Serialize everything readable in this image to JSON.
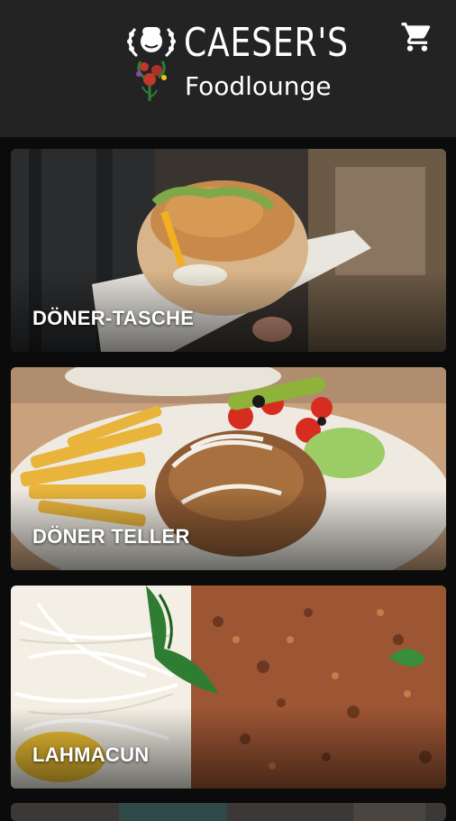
{
  "header": {
    "brand_title": "CAESER'S",
    "brand_subtitle": "Foodlounge",
    "cart_icon": "shopping-cart-icon"
  },
  "menu": {
    "categories": [
      {
        "label": "DÖNER-TASCHE"
      },
      {
        "label": "DÖNER TELLER"
      },
      {
        "label": "LAHMACUN"
      }
    ]
  },
  "colors": {
    "header_bg": "#232323",
    "page_bg": "#0b0b0b",
    "label_text": "#ffffff"
  }
}
